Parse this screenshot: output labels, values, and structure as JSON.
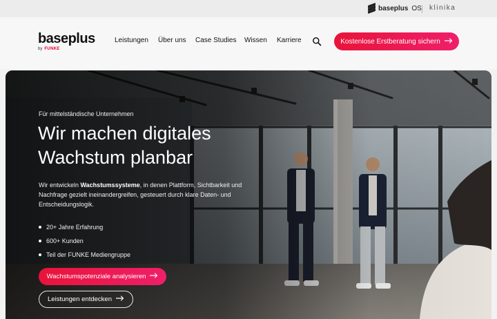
{
  "topbar": {
    "os_brand": "baseplus",
    "os_suffix": "OS",
    "klinika": "klinika"
  },
  "nav": {
    "logo": "baseplus",
    "logo_by": "by",
    "logo_parent": "FUNKE",
    "links": [
      "Leistungen",
      "Über uns",
      "Case Studies",
      "Wissen",
      "Karriere"
    ],
    "cta": "Kostenlose Erstberatung sichern"
  },
  "hero": {
    "eyebrow": "Für mittelständische Unternehmen",
    "headline_line1": "Wir machen digitales",
    "headline_line2": "Wachstum planbar",
    "desc_before": "Wir entwickeln ",
    "desc_bold": "Wachstumssysteme",
    "desc_after": ", in denen Plattform, Sichtbarkeit und Nachfrage gezielt ineinandergreifen, gesteuert durch klare Daten- und Entscheidungslogik.",
    "bullets": [
      "20+ Jahre Erfahrung",
      "600+ Kunden",
      "Teil der FUNKE Mediengruppe"
    ],
    "primary_button": "Wachstumspotenziale analysieren",
    "secondary_button": "Leistungen entdecken"
  },
  "colors": {
    "accent": "#e8143a",
    "accent_end": "#ef1f6a"
  }
}
